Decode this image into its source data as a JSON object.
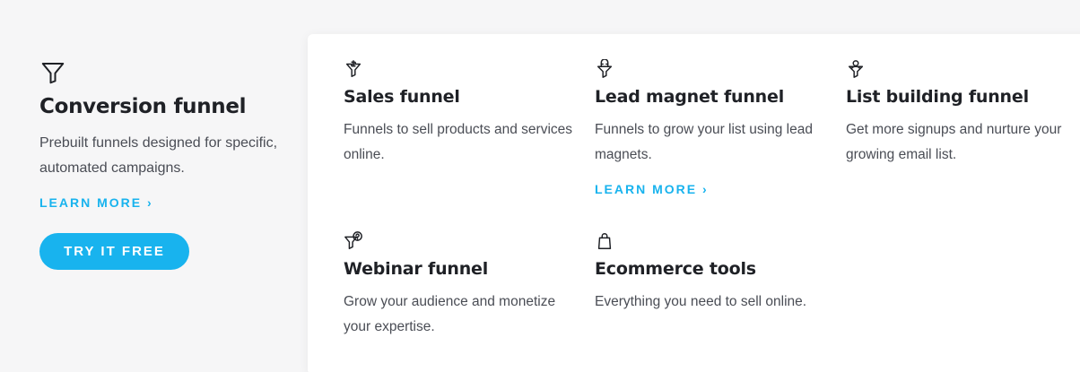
{
  "conversion": {
    "icon": "funnel-icon",
    "title": "Conversion funnel",
    "description": "Prebuilt funnels designed for specific, automated campaigns.",
    "learn_more": "LEARN MORE ›",
    "cta": "TRY IT FREE"
  },
  "items": [
    {
      "icon": "sales-funnel-icon",
      "title": "Sales funnel",
      "description": "Funnels to sell products and services online."
    },
    {
      "icon": "lead-magnet-icon",
      "title": "Lead magnet funnel",
      "description": "Funnels to grow your list using lead magnets.",
      "learn_more": "LEARN MORE ›"
    },
    {
      "icon": "list-building-icon",
      "title": "List building funnel",
      "description": "Get more signups and nurture your growing email list."
    },
    {
      "icon": "webinar-funnel-icon",
      "title": "Webinar funnel",
      "description": "Grow your audience and monetize your expertise."
    },
    {
      "icon": "shopping-bag-icon",
      "title": "Ecommerce tools",
      "description": "Everything you need to sell online."
    }
  ],
  "colors": {
    "accent": "#18b3ee",
    "heading": "#1f2126",
    "text": "#4a4d55",
    "background": "#f6f6f7",
    "panel": "#ffffff"
  }
}
